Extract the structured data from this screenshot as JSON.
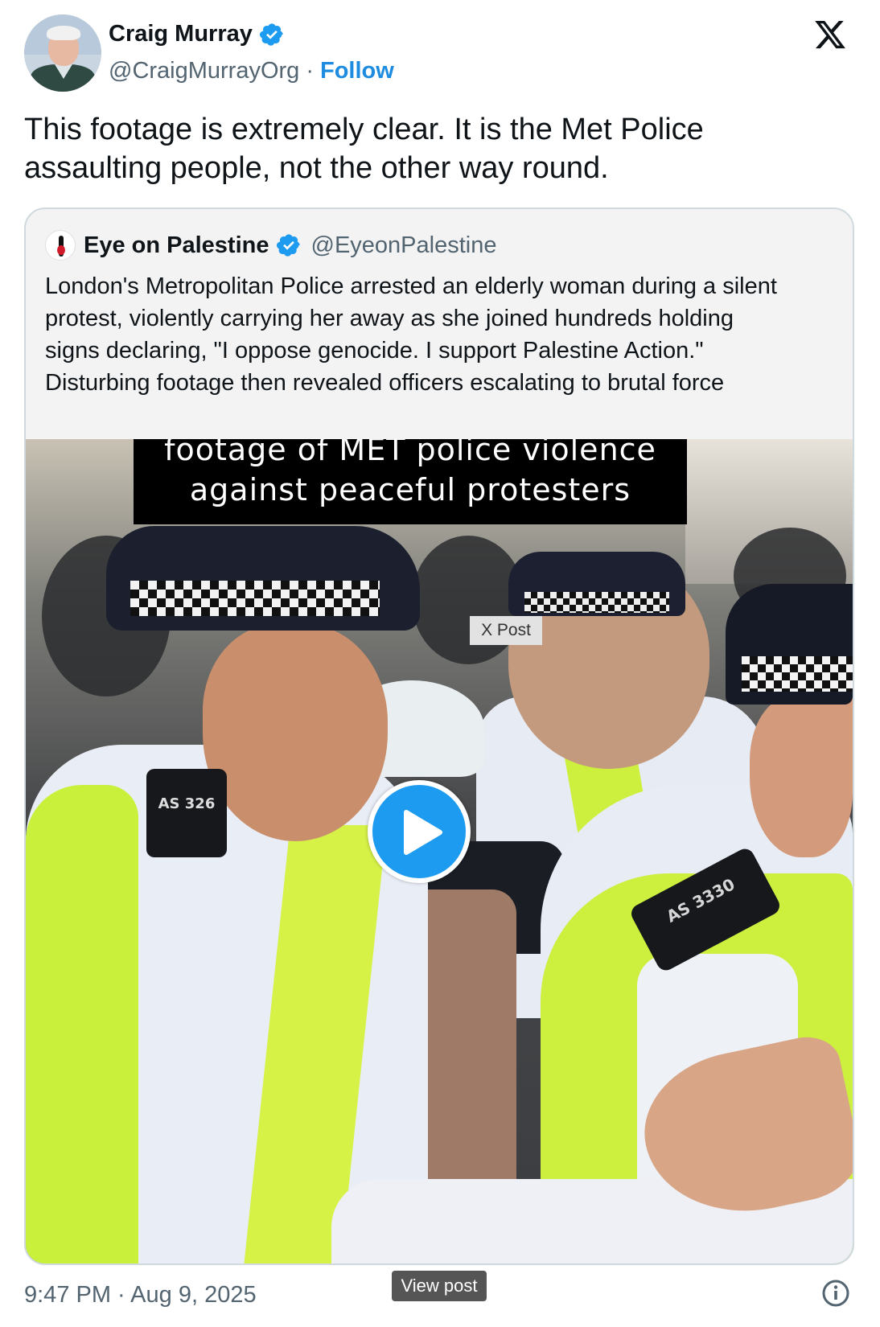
{
  "author": {
    "display_name": "Craig Murray",
    "handle": "@CraigMurrayOrg",
    "separator": "·",
    "follow_label": "Follow",
    "verified": true
  },
  "tweet": {
    "text_line1": "This footage is extremely clear.  It is the Met Police",
    "text_line2": "assaulting people, not the other way round."
  },
  "quoted": {
    "display_name": "Eye on Palestine",
    "handle": "@EyeonPalestine",
    "verified": true,
    "text_lines": [
      "London's Metropolitan Police arrested an elderly woman during a silent",
      "protest, violently carrying her away as she joined hundreds holding",
      "signs declaring, \"I oppose genocide. I support Palestine Action.\"",
      "Disturbing footage then revealed officers escalating to brutal force"
    ],
    "video": {
      "caption_line1": "footage of MET police violence",
      "caption_line2": "against peaceful protesters",
      "overlay_label": "X Post",
      "shoulder_badge_left": "AS 326",
      "shoulder_badge_right": "AS 3330"
    }
  },
  "footer": {
    "timestamp": "9:47 PM · Aug 9, 2025",
    "view_post_label": "View post"
  },
  "colors": {
    "accent_blue": "#1d9bf0",
    "follow_blue": "#1d8ce0",
    "secondary_text": "#536471"
  },
  "icons": [
    "verified-badge-icon",
    "x-logo-icon",
    "play-icon",
    "info-icon"
  ]
}
